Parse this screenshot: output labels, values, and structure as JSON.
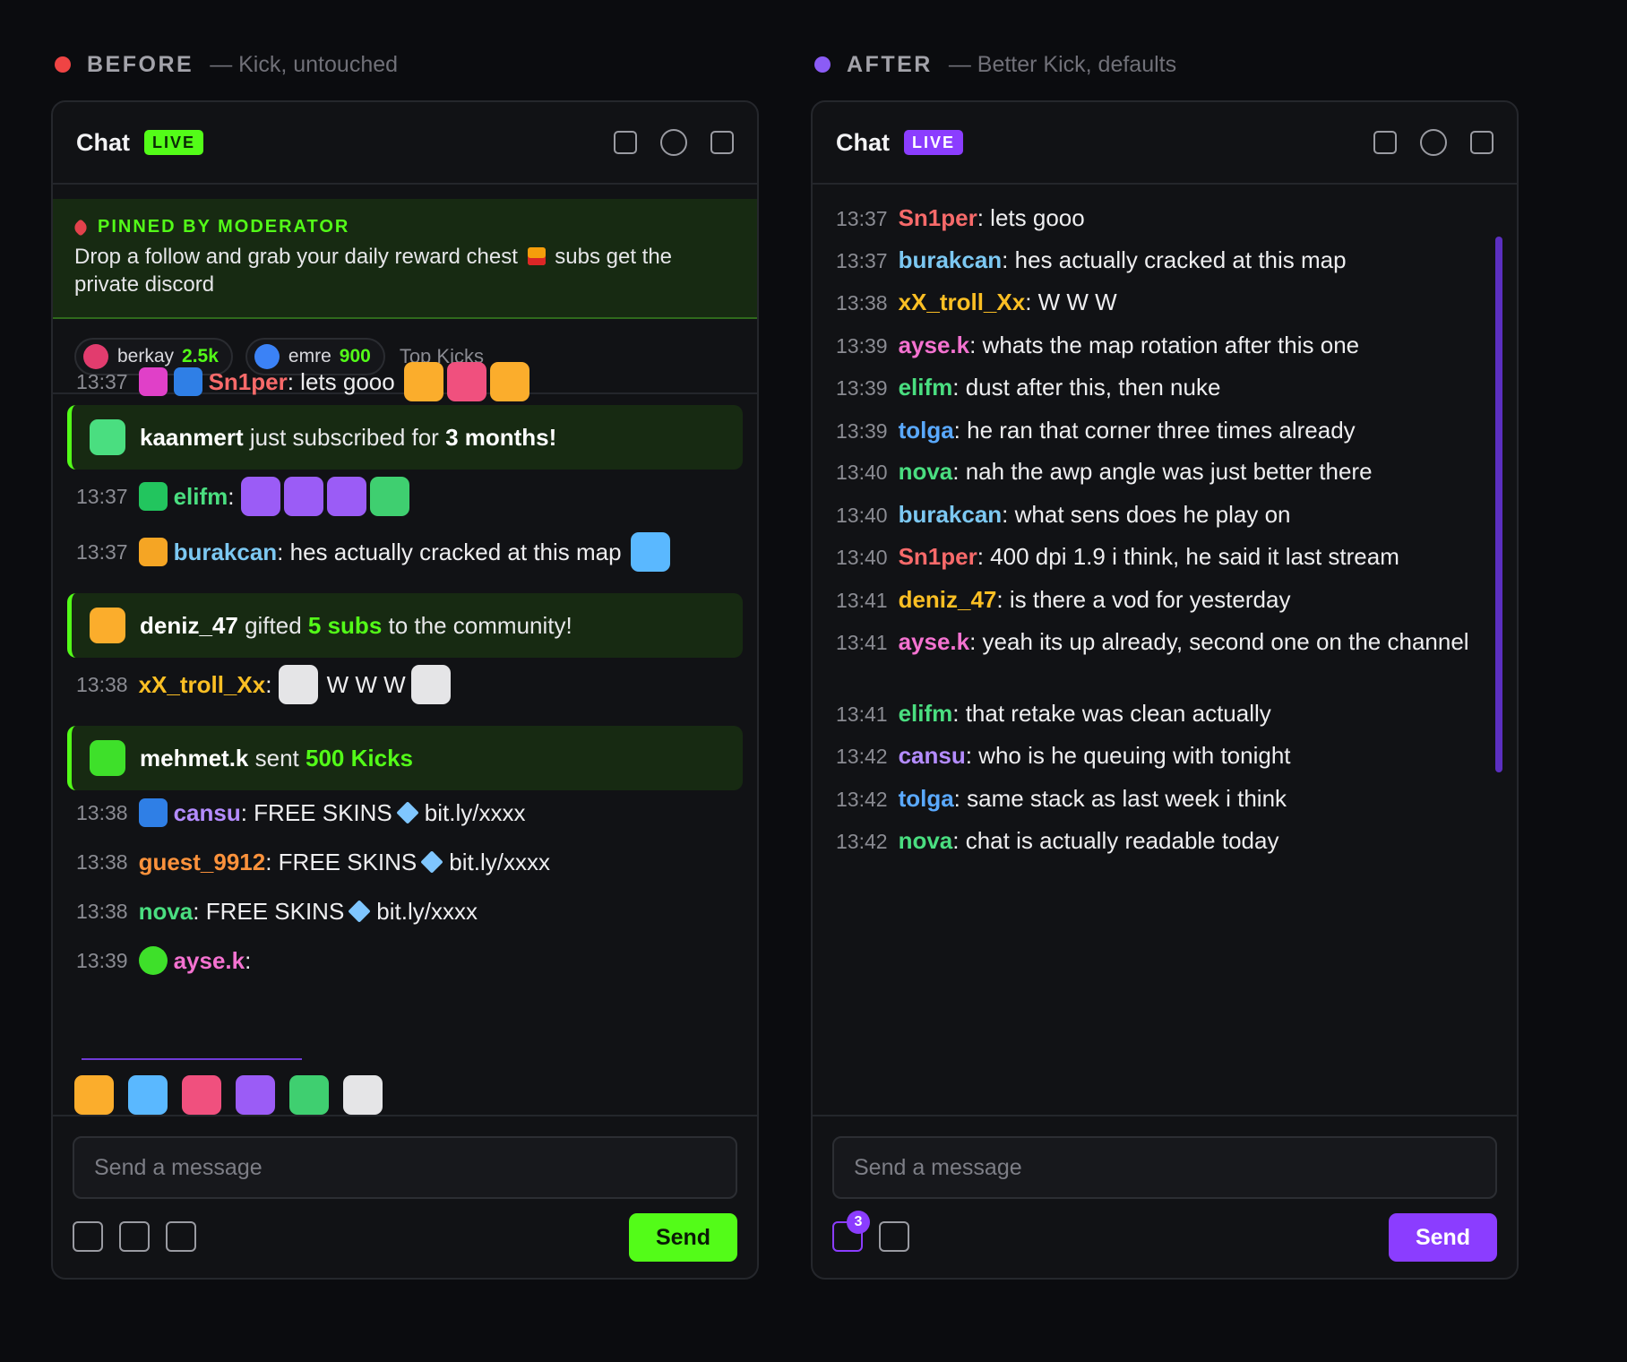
{
  "colors": {
    "kick_green": "#53fc18",
    "bk_purple": "#8b3dff",
    "before_dot": "#ef4444",
    "after_dot": "#8b5cf6",
    "u_red": "#f76a6a",
    "u_blue": "#7cc8f2",
    "u_green": "#4ade80",
    "u_yellow": "#fbbf24",
    "u_pink": "#f472d0",
    "u_violet": "#b48cff",
    "u_orange": "#fb923c",
    "u_sky": "#5aa9ff"
  },
  "before": {
    "label": "BEFORE",
    "sublabel": "— Kick, untouched",
    "chat_title": "Chat",
    "live": "LIVE",
    "pinned": {
      "heading": "PINNED BY MODERATOR",
      "text_1": "Drop a follow and grab your daily reward chest",
      "gift_icon": "gift-icon",
      "text_2": "subs get the",
      "text_3": "private discord"
    },
    "leaderboard": [
      {
        "name": "berkay",
        "amount": "2.5k"
      },
      {
        "name": "emre",
        "amount": "900"
      }
    ],
    "top_kicks": "Top Kicks",
    "messages": {
      "m1": {
        "time": "13:37",
        "user": "Sn1per",
        "text": "lets gooo"
      },
      "ev1": {
        "user": "kaanmert",
        "mid": "just subscribed for",
        "hi": "3 months!"
      },
      "m2": {
        "time": "13:37",
        "user": "elifm",
        "text": ""
      },
      "m3": {
        "time": "13:37",
        "user": "burakcan",
        "text": "hes actually cracked at this map"
      },
      "ev2": {
        "user": "deniz_47",
        "mid": "gifted",
        "hi": "5 subs",
        "tail": "to the community!"
      },
      "m4": {
        "time": "13:38",
        "user": "xX_troll_Xx",
        "text": "W W W"
      },
      "ev3": {
        "user": "mehmet.k",
        "mid": "sent",
        "hi": "500 Kicks"
      },
      "m5": {
        "time": "13:38",
        "user": "cansu",
        "t1": "FREE SKINS",
        "t2": "bit.ly/xxxx"
      },
      "m6": {
        "time": "13:38",
        "user": "guest_9912",
        "t1": "FREE SKINS",
        "t2": "bit.ly/xxxx"
      },
      "m7": {
        "time": "13:38",
        "user": "nova",
        "t1": "FREE SKINS",
        "t2": "bit.ly/xxxx"
      },
      "m8": {
        "time": "13:39",
        "user": "ayse.k",
        "text": ""
      }
    },
    "input_placeholder": "Send a message",
    "send": "Send"
  },
  "after": {
    "label": "AFTER",
    "sublabel": "— Better Kick, defaults",
    "chat_title": "Chat",
    "live": "LIVE",
    "messages": [
      {
        "time": "13:37",
        "user": "Sn1per",
        "text": "lets gooo",
        "color": "#f76a6a"
      },
      {
        "time": "13:37",
        "user": "burakcan",
        "text": "hes actually cracked at this map",
        "color": "#7cc8f2"
      },
      {
        "time": "13:38",
        "user": "xX_troll_Xx",
        "text": "W W W",
        "color": "#fbbf24"
      },
      {
        "time": "13:39",
        "user": "ayse.k",
        "text": "whats the map rotation after this one",
        "color": "#f472d0"
      },
      {
        "time": "13:39",
        "user": "elifm",
        "text": "dust after this, then nuke",
        "color": "#4ade80"
      },
      {
        "time": "13:39",
        "user": "tolga",
        "text": "he ran that corner three times already",
        "color": "#5aa9ff"
      },
      {
        "time": "13:40",
        "user": "nova",
        "text": "nah the awp angle was just better there",
        "color": "#4ade80"
      },
      {
        "time": "13:40",
        "user": "burakcan",
        "text": "what sens does he play on",
        "color": "#7cc8f2"
      },
      {
        "time": "13:40",
        "user": "Sn1per",
        "text": "400 dpi 1.9 i think, he said it last stream",
        "color": "#f76a6a"
      },
      {
        "time": "13:41",
        "user": "deniz_47",
        "text": "is there a vod for yesterday",
        "color": "#fbbf24"
      },
      {
        "time": "13:41",
        "user": "ayse.k",
        "text": "yeah its up already, second one on the channel",
        "color": "#f472d0"
      },
      {
        "time": "13:41",
        "user": "elifm",
        "text": "that retake was clean actually",
        "color": "#4ade80"
      },
      {
        "time": "13:42",
        "user": "cansu",
        "text": "who is he queuing with tonight",
        "color": "#b48cff"
      },
      {
        "time": "13:42",
        "user": "tolga",
        "text": "same stack as last week i think",
        "color": "#5aa9ff"
      },
      {
        "time": "13:42",
        "user": "nova",
        "text": "chat is actually readable today",
        "color": "#4ade80"
      }
    ],
    "badge_count": "3",
    "input_placeholder": "Send a message",
    "send": "Send"
  }
}
